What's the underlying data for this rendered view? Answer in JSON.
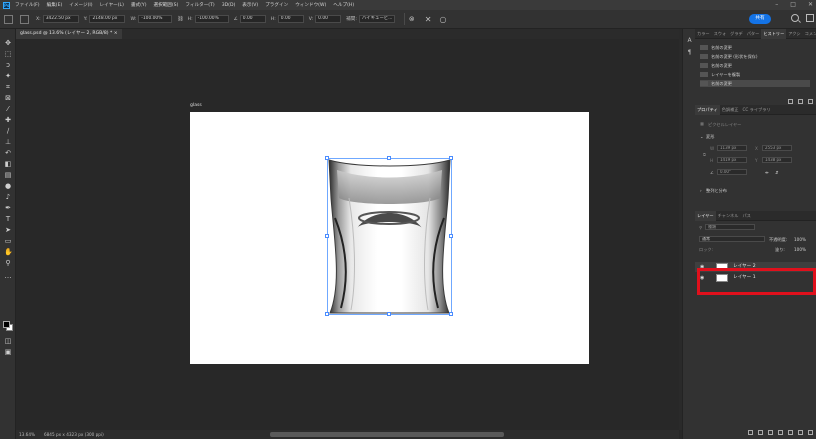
{
  "menu": {
    "app_logo": "Ps",
    "items": [
      "ファイル(F)",
      "編集(E)",
      "イメージ(I)",
      "レイヤー(L)",
      "書式(Y)",
      "選択範囲(S)",
      "フィルター(T)",
      "3D(D)",
      "表示(V)",
      "プラグイン",
      "ウィンドウ(W)",
      "ヘルプ(H)"
    ]
  },
  "options": {
    "x_label": "X:",
    "x_value": "3422.50 px",
    "y_label": "Y:",
    "y_value": "2148.00 px",
    "w_label": "W:",
    "w_value": "-100.00%",
    "h_label": "H:",
    "h_value": "-100.00%",
    "angle_value": "0.00",
    "h_skew_label": "H:",
    "h_skew_value": "0.00",
    "v_skew_label": "V:",
    "v_skew_value": "0.00",
    "interp_label": "補間:",
    "interp_value": "バイキュービ...",
    "share_label": "共有"
  },
  "document": {
    "tab_label": "glass.psd @ 13.6% (レイヤー 2, RGB/8) *",
    "artboard_label": "glass"
  },
  "status": {
    "zoom": "13.64%",
    "doc_info": "6845 px x 4323 px (300 ppi)"
  },
  "history_panel": {
    "tabs": [
      "カラー",
      "スウォ",
      "グラデ",
      "パター",
      "ヒストリー",
      "アクシ",
      "コメン"
    ],
    "active_tab": 4,
    "items": [
      "名前の変更",
      "名前の変更 (形状を保存)",
      "名前の変更",
      "レイヤーを複製",
      "名前の変更"
    ],
    "selected_index": 4
  },
  "properties_panel": {
    "tabs": [
      "プロパティ",
      "色調補正",
      "CC ライブラリ"
    ],
    "layer_type": "ピクセルレイヤー",
    "transform_label": "変形",
    "w_label": "W",
    "w_value": "1139 px",
    "x_label": "X",
    "x_value": "2553 px",
    "h_label": "H",
    "h_value": "1419 px",
    "y_label": "Y",
    "y_value": "1438 px",
    "angle_value": "0.00°",
    "align_label": "整列と分布"
  },
  "layers_panel": {
    "tabs": [
      "レイヤー",
      "チャンネル",
      "パス"
    ],
    "filter_label": "種類",
    "blend_mode": "通常",
    "opacity_label": "不透明度:",
    "opacity_value": "100%",
    "lock_label": "ロック:",
    "fill_label": "塗り:",
    "fill_value": "100%",
    "layers": [
      {
        "name": "レイヤー 2",
        "selected": true
      },
      {
        "name": "レイヤー 1",
        "selected": false
      }
    ]
  },
  "colors": {
    "accent": "#1473e6",
    "highlight_box": "#e0101c",
    "canvas_bg": "#282828",
    "panel_bg": "#323232"
  }
}
